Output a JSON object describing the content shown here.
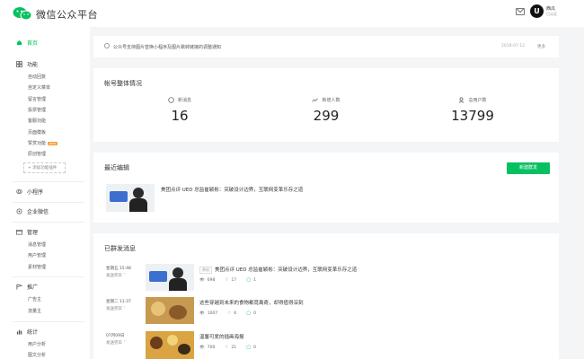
{
  "header": {
    "brand": "微信公众平台",
    "user_initial": "U",
    "user_name": "西瓜",
    "user_role": "已认证"
  },
  "sidebar": {
    "home": "首页",
    "feature": "功能",
    "feature_items": [
      "自动回复",
      "自定义菜单",
      "留言管理",
      "投票管理",
      "客服功能",
      "页面模板",
      "赞赏功能",
      "原创管理"
    ],
    "new_badge": "NEW",
    "add_plugin": "+ 添加功能插件",
    "mini_program": "小程序",
    "enterprise_wechat": "企业微信",
    "manage": "管理",
    "manage_items": [
      "消息管理",
      "用户管理",
      "素材管理"
    ],
    "promotion": "推广",
    "promotion_items": [
      "广告主",
      "流量主"
    ],
    "statistics": "统计",
    "statistics_items": [
      "用户分析",
      "图文分析"
    ]
  },
  "notice": {
    "text": "公众号支持图片替换小程序及图片跳转链接的调整通知",
    "date": "2018-07-12",
    "more": "更多"
  },
  "overview": {
    "title": "帐号整体情况",
    "stats": [
      {
        "label": "新消息",
        "value": "16"
      },
      {
        "label": "新增人数",
        "value": "299"
      },
      {
        "label": "总用户数",
        "value": "13799"
      }
    ]
  },
  "recent": {
    "title": "最近编辑",
    "new_button": "新建群发",
    "article_title": "美团点评 UED 总监崔颖彬：突破设计边界，互联网变革乐存之道"
  },
  "sent": {
    "title": "已群发消息",
    "original_tag": "原创",
    "messages": [
      {
        "time": "星期五 15:48",
        "status": "发送完毕 ˅",
        "title": "美团点评 UED 总监崔颖彬：突破设计边界，互联网变革乐存之道",
        "views": "698",
        "likes": "17",
        "comments": "1"
      },
      {
        "time": "星期二 11:37",
        "status": "发送完毕 ˅",
        "title": "这些穿越到未来的食物都竟离奇，却得值得深刻",
        "views": "1007",
        "likes": "6",
        "comments": "0"
      },
      {
        "time": "07月09日",
        "status": "发送完毕 ˅",
        "title": "温馨可爱的插画海报",
        "views": "700",
        "likes": "21",
        "comments": "0"
      }
    ]
  },
  "colors": {
    "accent": "#07c160",
    "badge": "#fa9d3b"
  }
}
